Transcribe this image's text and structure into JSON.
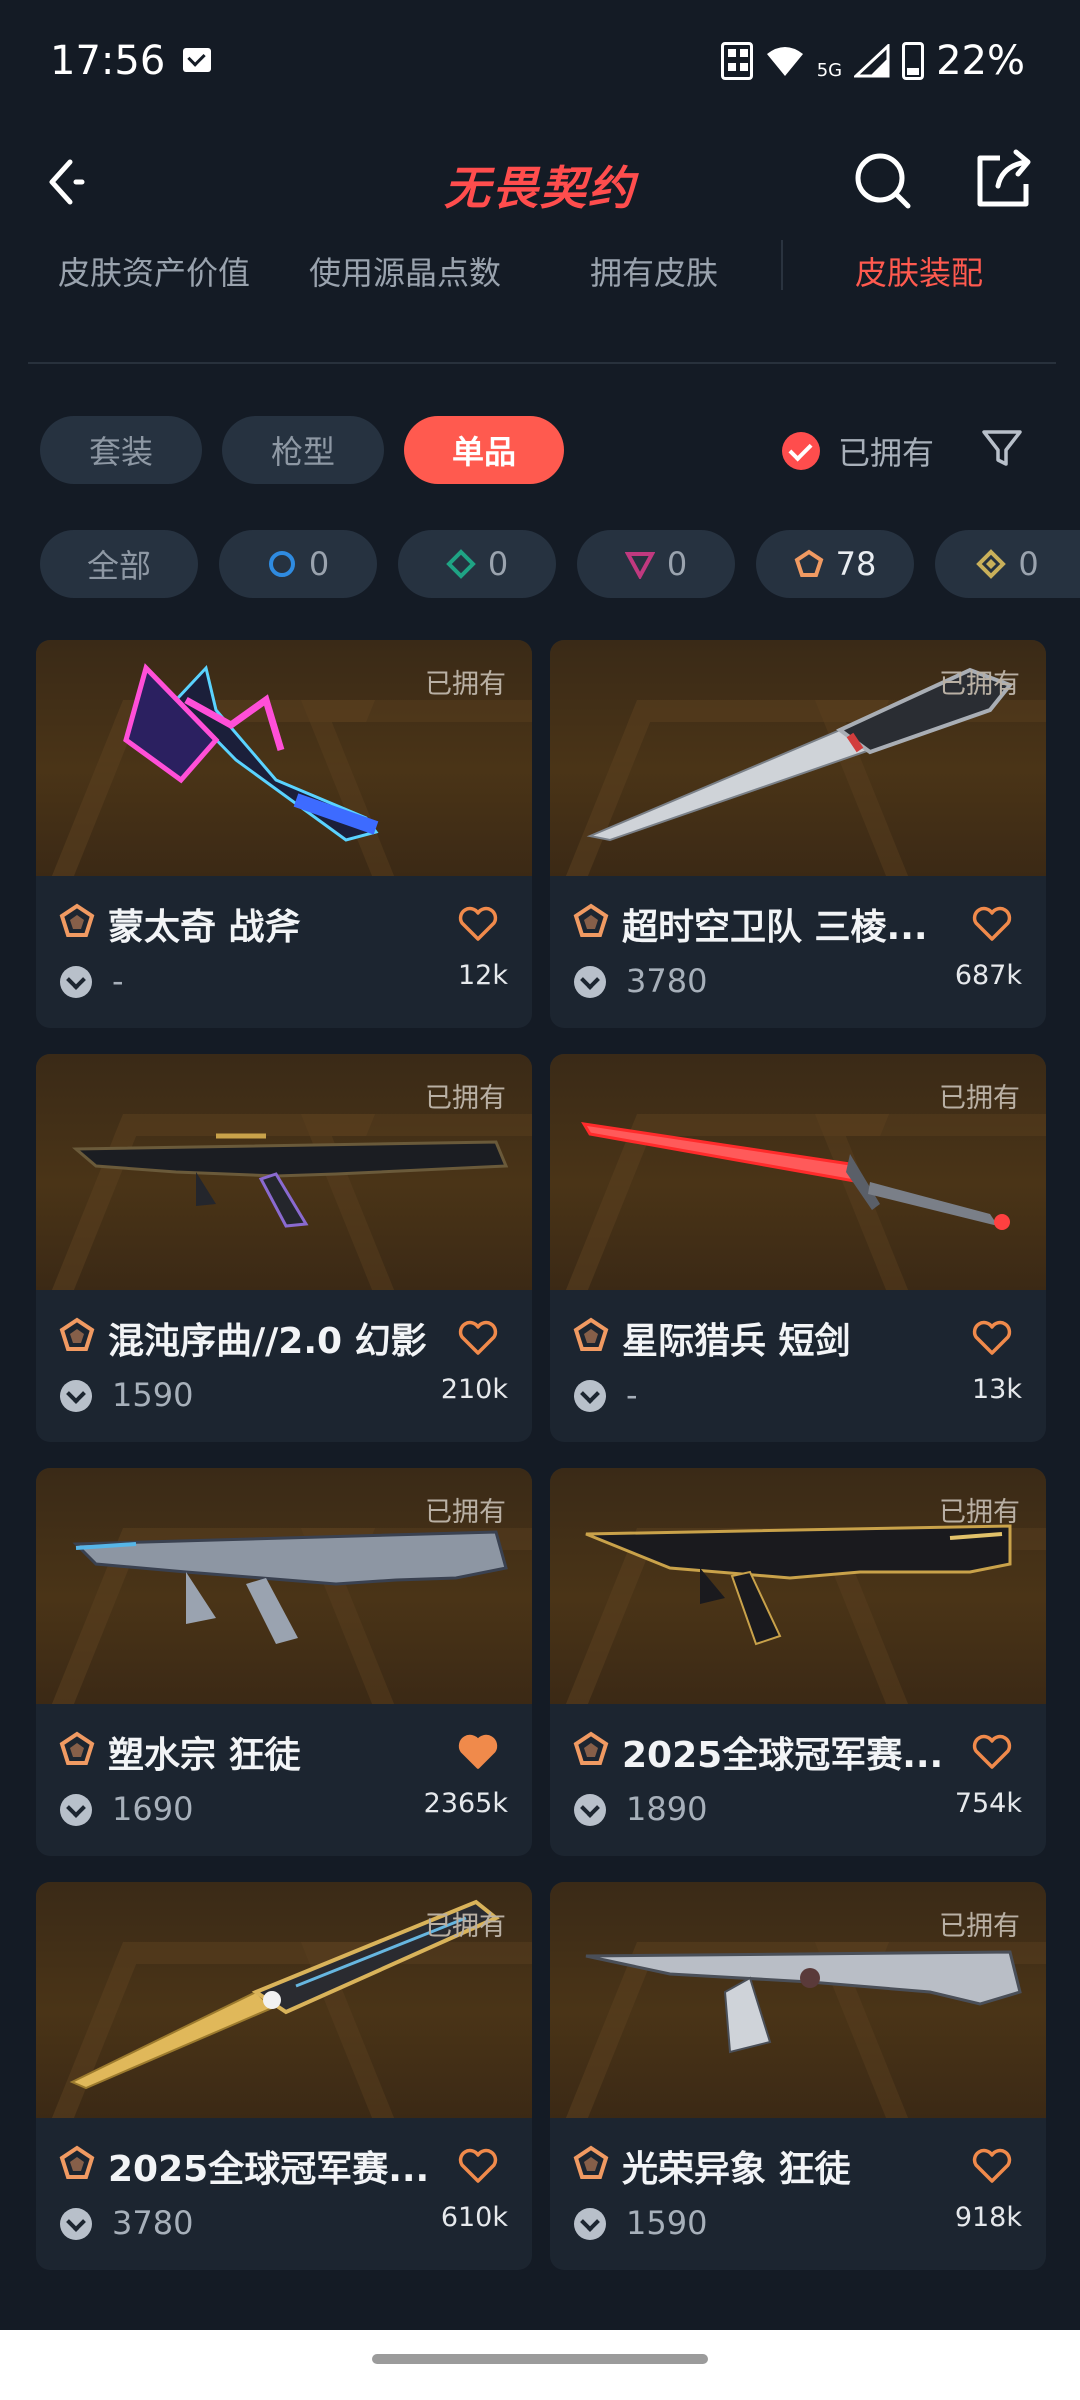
{
  "status": {
    "time": "17:56",
    "network": "5G",
    "battery": "22%"
  },
  "header": {
    "title": "无畏契约"
  },
  "tabs": [
    {
      "label": "皮肤资产价值"
    },
    {
      "label": "使用源晶点数"
    },
    {
      "label": "拥有皮肤"
    },
    {
      "label": "皮肤装配",
      "active": true
    }
  ],
  "filters": {
    "types": [
      {
        "label": "套装"
      },
      {
        "label": "枪型"
      },
      {
        "label": "单品",
        "active": true
      }
    ],
    "owned_label": "已拥有"
  },
  "tiers": {
    "all_label": "全部",
    "items": [
      {
        "icon": "blue-circle-tier-icon",
        "color": "#2f8be0",
        "count": "0"
      },
      {
        "icon": "green-diamond-tier-icon",
        "color": "#1fa384",
        "count": "0"
      },
      {
        "icon": "pink-triangle-tier-icon",
        "color": "#c0397f",
        "count": "0"
      },
      {
        "icon": "orange-pentagon-tier-icon",
        "color": "#f09a62",
        "count": "78"
      },
      {
        "icon": "gold-diamond-tier-icon",
        "color": "#c9b05a",
        "count": "0"
      }
    ]
  },
  "cards": [
    {
      "name": "蒙太奇 战斧",
      "price": "-",
      "likes": "12k",
      "owned": "已拥有",
      "favorited": false
    },
    {
      "name": "超时空卫队 三棱...",
      "price": "3780",
      "likes": "687k",
      "owned": "已拥有",
      "favorited": false
    },
    {
      "name": "混沌序曲//2.0 幻影",
      "price": "1590",
      "likes": "210k",
      "owned": "已拥有",
      "favorited": false
    },
    {
      "name": "星际猎兵 短剑",
      "price": "-",
      "likes": "13k",
      "owned": "已拥有",
      "favorited": false
    },
    {
      "name": "塑水宗 狂徒",
      "price": "1690",
      "likes": "2365k",
      "owned": "已拥有",
      "favorited": true
    },
    {
      "name": "2025全球冠军赛...",
      "price": "1890",
      "likes": "754k",
      "owned": "已拥有",
      "favorited": false
    },
    {
      "name": "2025全球冠军赛...",
      "price": "3780",
      "likes": "610k",
      "owned": "已拥有",
      "favorited": false
    },
    {
      "name": "光荣异象 狂徒",
      "price": "1590",
      "likes": "918k",
      "owned": "已拥有",
      "favorited": false
    }
  ],
  "colors": {
    "accent": "#ff5a4f",
    "tier_badge": "#f09a62",
    "heart": "#f08a4b",
    "background": "#141b25"
  }
}
